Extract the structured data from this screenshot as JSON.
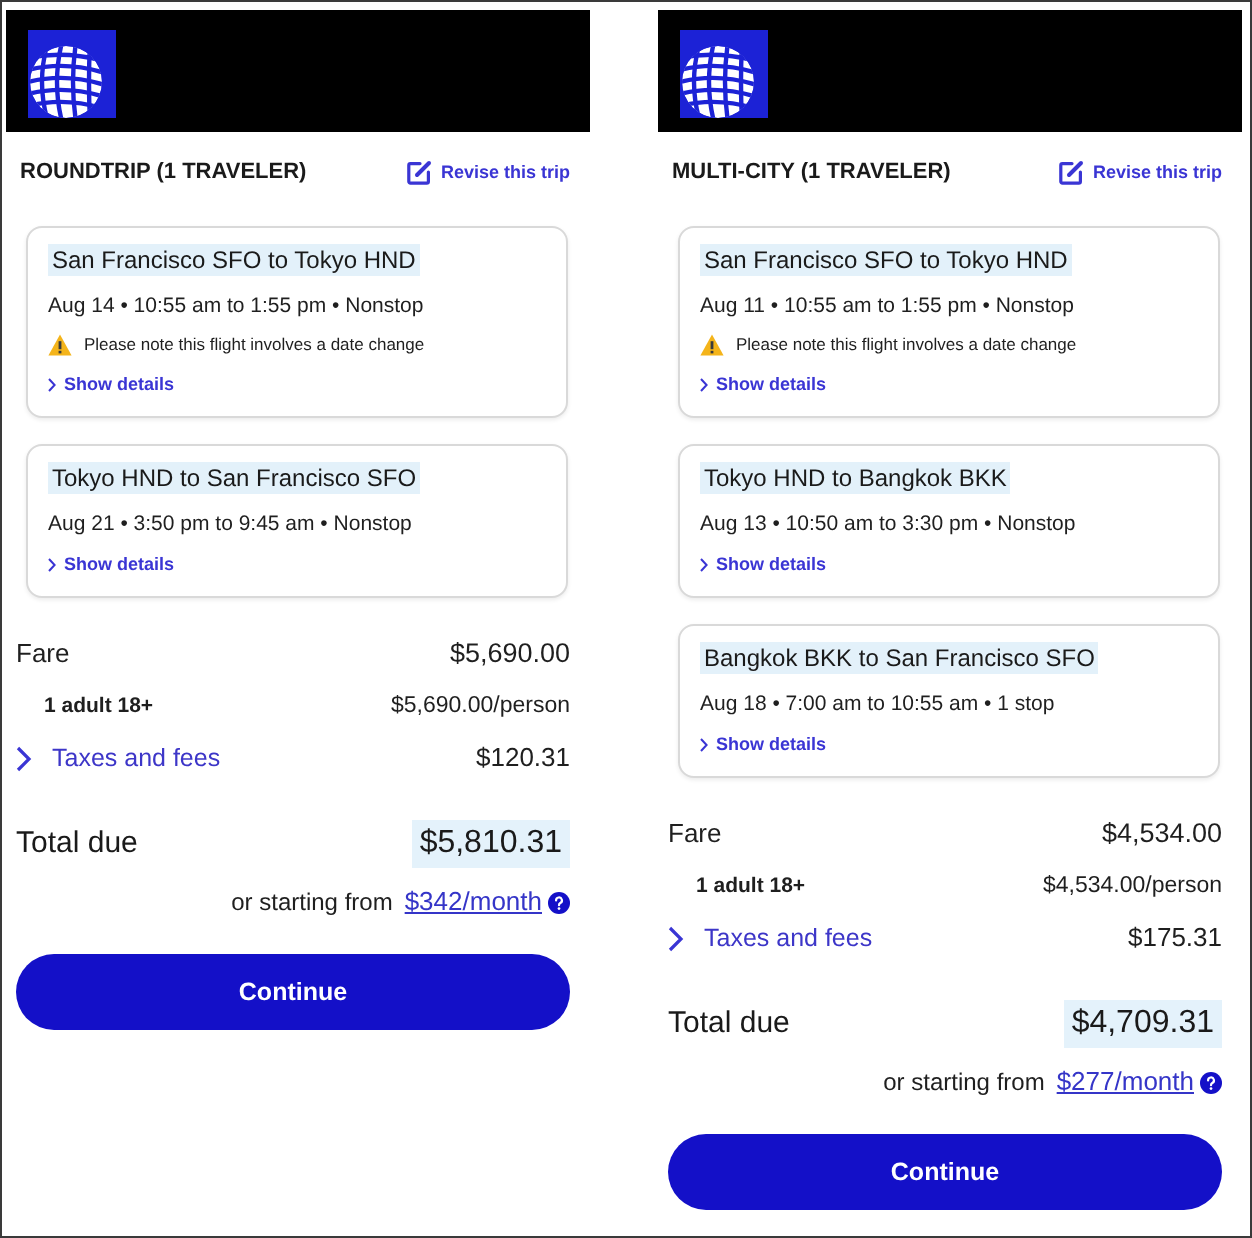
{
  "panels": [
    {
      "trip_type": "ROUNDTRIP (1 TRAVELER)",
      "revise_link": "Revise this trip",
      "flights": [
        {
          "route": "San Francisco SFO to Tokyo HND",
          "schedule": "Aug 14 • 10:55 am to 1:55 pm • Nonstop",
          "notice": "Please note this flight involves a date change",
          "details_link": "Show details"
        },
        {
          "route": "Tokyo HND to San Francisco SFO",
          "schedule": "Aug 21 • 3:50 pm to 9:45 am • Nonstop",
          "details_link": "Show details"
        }
      ],
      "fare": {
        "label": "Fare",
        "amount": "$5,690.00"
      },
      "traveler": {
        "label": "1 adult 18+",
        "amount": "$5,690.00/person"
      },
      "taxes": {
        "label": "Taxes and fees",
        "amount": "$120.31"
      },
      "total": {
        "label": "Total due",
        "amount": "$5,810.31"
      },
      "financing": {
        "text": "or starting from",
        "link": "$342/month"
      },
      "button": "Continue"
    },
    {
      "trip_type": "MULTI-CITY (1 TRAVELER)",
      "revise_link": "Revise this trip",
      "flights": [
        {
          "route": "San Francisco SFO to Tokyo HND",
          "schedule": "Aug 11 • 10:55 am to 1:55 pm • Nonstop",
          "notice": "Please note this flight involves a date change",
          "details_link": "Show details"
        },
        {
          "route": "Tokyo HND to Bangkok BKK",
          "schedule": "Aug 13 • 10:50 am to 3:30 pm • Nonstop",
          "details_link": "Show details"
        },
        {
          "route": "Bangkok BKK to San Francisco SFO",
          "schedule": "Aug 18 • 7:00 am to 10:55 am • 1 stop",
          "details_link": "Show details"
        }
      ],
      "fare": {
        "label": "Fare",
        "amount": "$4,534.00"
      },
      "traveler": {
        "label": "1 adult 18+",
        "amount": "$4,534.00/person"
      },
      "taxes": {
        "label": "Taxes and fees",
        "amount": "$175.31"
      },
      "total": {
        "label": "Total due",
        "amount": "$4,709.31"
      },
      "financing": {
        "text": "or starting from",
        "link": "$277/month"
      },
      "button": "Continue"
    }
  ]
}
